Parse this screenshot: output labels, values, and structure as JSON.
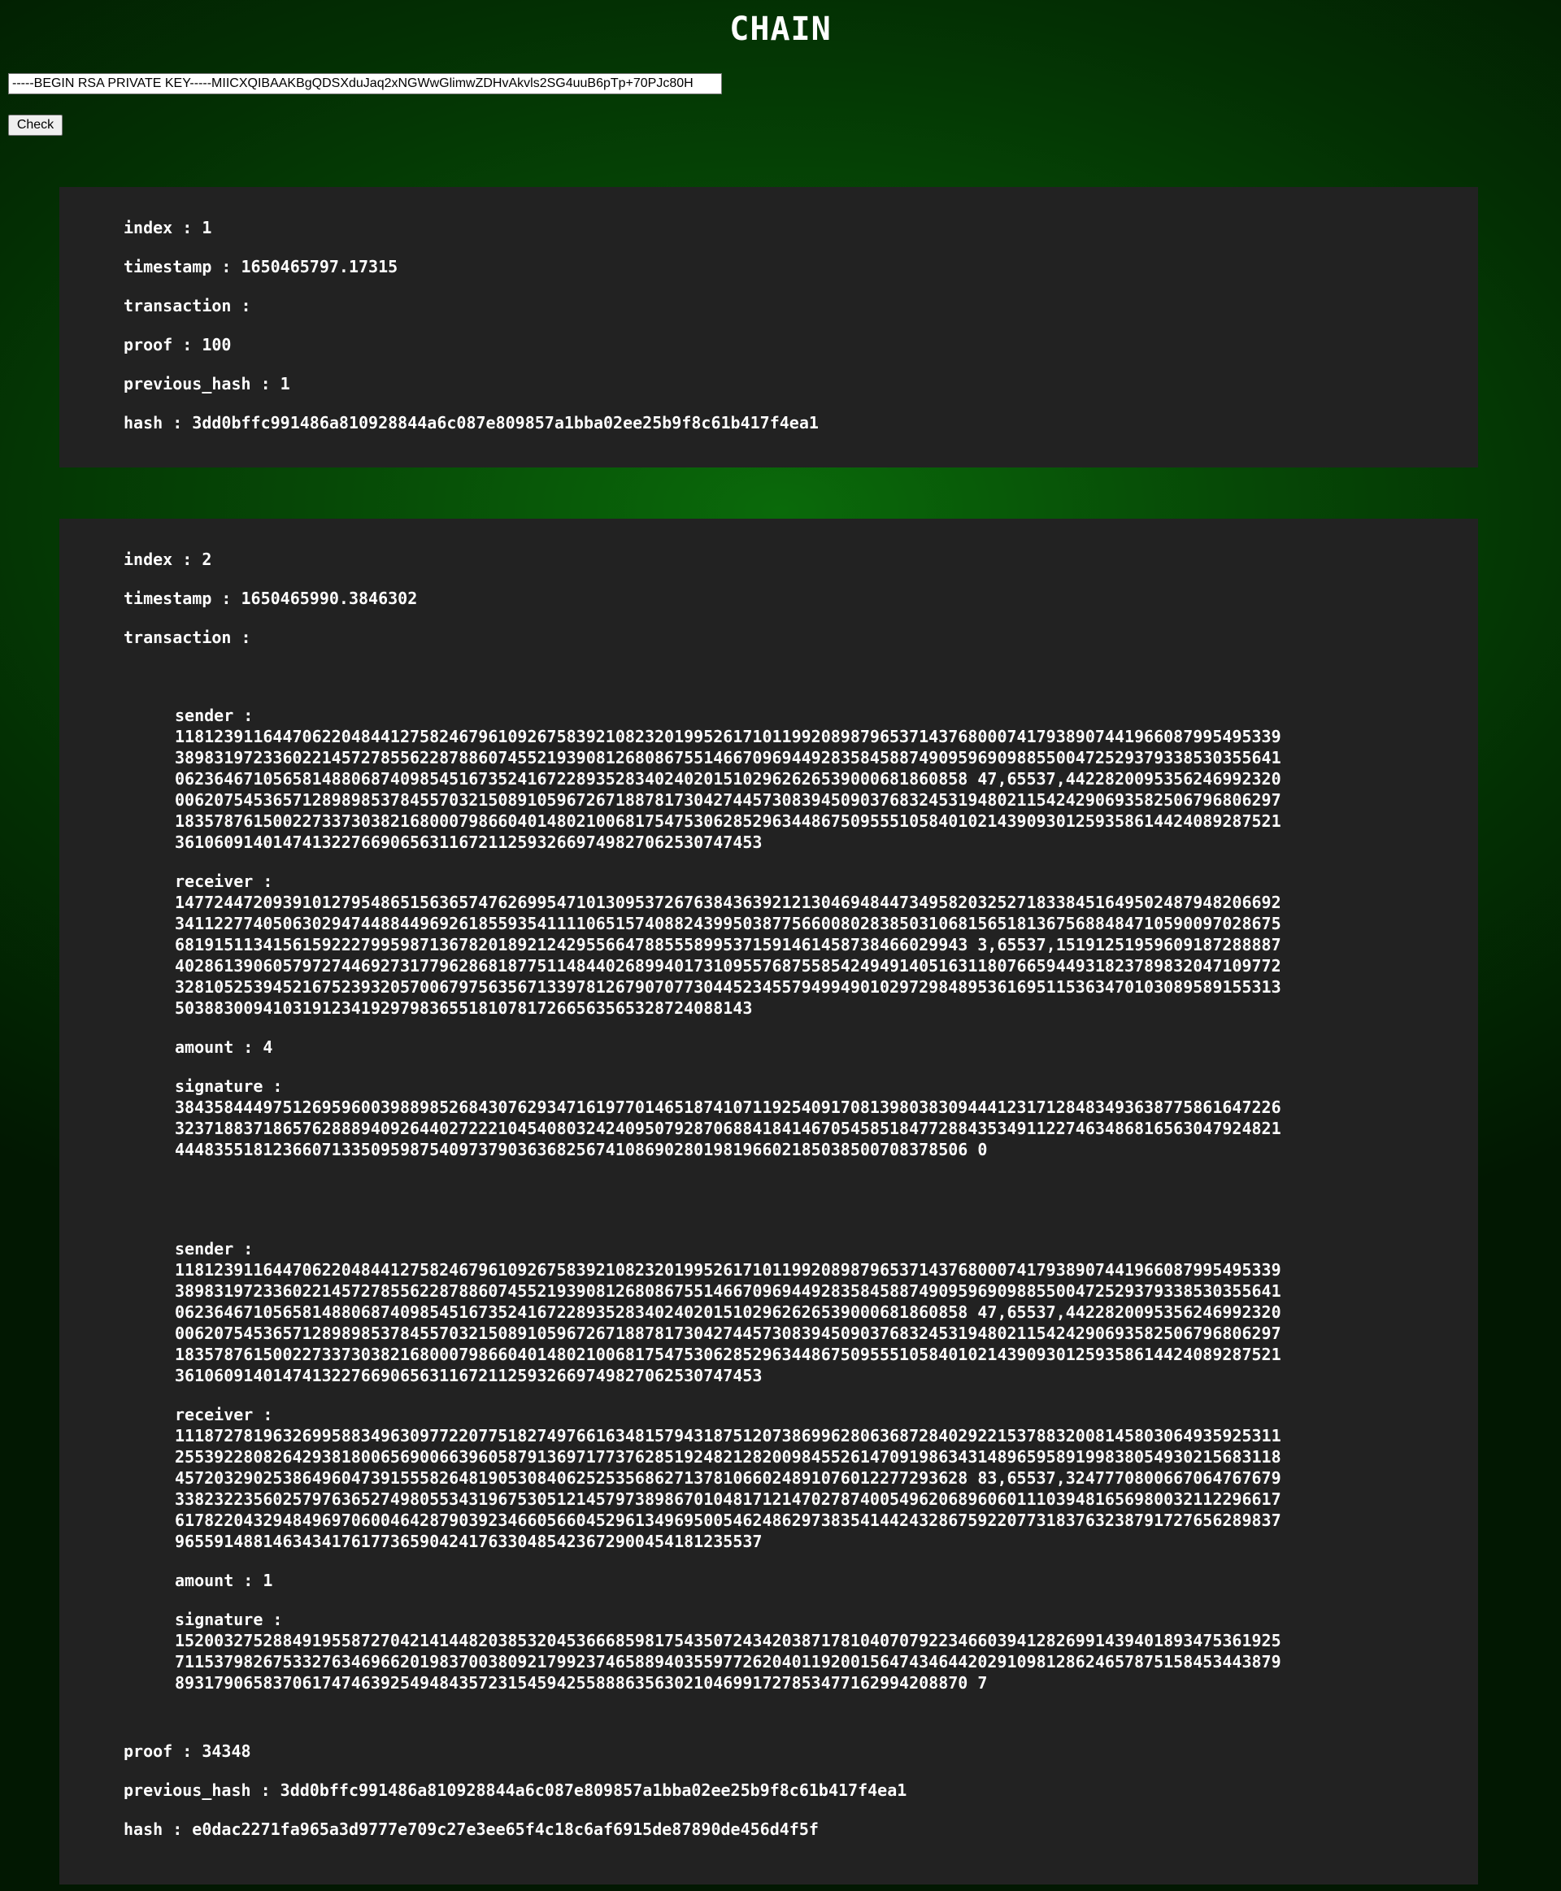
{
  "page": {
    "title": "CHAIN"
  },
  "key_form": {
    "value": "-----BEGIN RSA PRIVATE KEY-----MIICXQIBAAKBgQDSXduJaq2xNGWwGlimwZDHvAkvls2SG4uuB6pTp+70PJc80H",
    "button_label": "Check"
  },
  "labels": {
    "index": "index :",
    "timestamp": "timestamp :",
    "transaction": "transaction :",
    "proof": "proof :",
    "previous_hash": "previous_hash :",
    "hash": "hash :",
    "sender": "sender :",
    "receiver": "receiver :",
    "amount": "amount :",
    "signature": "signature :"
  },
  "blocks": [
    {
      "index": "1",
      "timestamp": "1650465797.17315",
      "proof": "100",
      "previous_hash": "1",
      "hash": "3dd0bffc991486a810928844a6c087e809857a1bba02ee25b9f8c61b417f4ea1",
      "transactions": []
    },
    {
      "index": "2",
      "timestamp": "1650465990.3846302",
      "proof": "34348",
      "previous_hash": "3dd0bffc991486a810928844a6c087e809857a1bba02ee25b9f8c61b417f4ea1",
      "hash": "e0dac2271fa965a3d9777e709c27e3ee65f4c18c6af6915de87890de456d4f5f",
      "transactions": [
        {
          "sender": "1181239116447062204844127582467961092675839210823201995261710119920898796537143768000741793890744196608799549533938983197233602214572785562287886074552193908126808675514667096944928358458874909596909885500472529379338530355641062364671056581488068740985451673524167228935283402402015102962626539000681860858 47,65537,44228200953562469923200062075453657128989853784557032150891059672671887817304274457308394509037683245319480211542429069358250679680629718357876150022733730382168000798660401480210068175475306285296344867509555105840102143909301259358614424089287521361060914014741322766906563116721125932669749827062530747453",
          "receiver": "1477244720939101279548651563657476269954710130953726763843639212130469484473495820325271833845164950248794820669234112277405063029474488449692618559354111106515740882439950387756600802838503106815651813675688484710590097028675681915113415615922279959871367820189212429556647885558995371591461458738466029943 3,65537,15191251959609187288887402861390605797274469273177962868187751148440268994017310955768755854249491405163118076659449318237898320471097723281052539452167523932057006797563567133978126790707730445234557949949010297298489536169511536347010308958915531350388300941031912341929798365518107817266563565328724088143",
          "amount": "4",
          "signature": "3843584449751269596003988985268430762934716197701465187410711925409170813980383094441231712848349363877586164722632371883718657628889409264402722210454080324240950792870688418414670545851847728843534911227463486816563047924821444835518123660713350959875409737903636825674108690280198196602185038500708378506 0"
        },
        {
          "sender": "1181239116447062204844127582467961092675839210823201995261710119920898796537143768000741793890744196608799549533938983197233602214572785562287886074552193908126808675514667096944928358458874909596909885500472529379338530355641062364671056581488068740985451673524167228935283402402015102962626539000681860858 47,65537,44228200953562469923200062075453657128989853784557032150891059672671887817304274457308394509037683245319480211542429069358250679680629718357876150022733730382168000798660401480210068175475306285296344867509555105840102143909301259358614424089287521361060914014741322766906563116721125932669749827062530747453",
          "receiver": "1118727819632699588349630977220775182749766163481579431875120738699628063687284029221537883200814580306493592531125539228082642938180065690066396058791369717737628519248212820098455261470919863431489659589199838054930215683118457203290253864960473915558264819053084062525356862713781066024891076012277293628 83,65537,32477708006670647676793382322356025797636527498055343196753051214579738986701048171214702787400549620689606011103948165698003211229661761782204329484969706004642879039234660566045296134969500546248629738354144243286759220773183763238791727656289837965591488146343417617736590424176330485423672900454181235537",
          "amount": "1",
          "signature": "1520032752884919558727042141448203853204536668598175435072434203871781040707922346603941282699143940189347536192571153798267533276346966201983700380921799237465889403559772620401192001564743464420291098128624657875158453443879893179065837061747463925494843572315459425588863563021046991727853477162994208870 7"
        }
      ]
    }
  ]
}
